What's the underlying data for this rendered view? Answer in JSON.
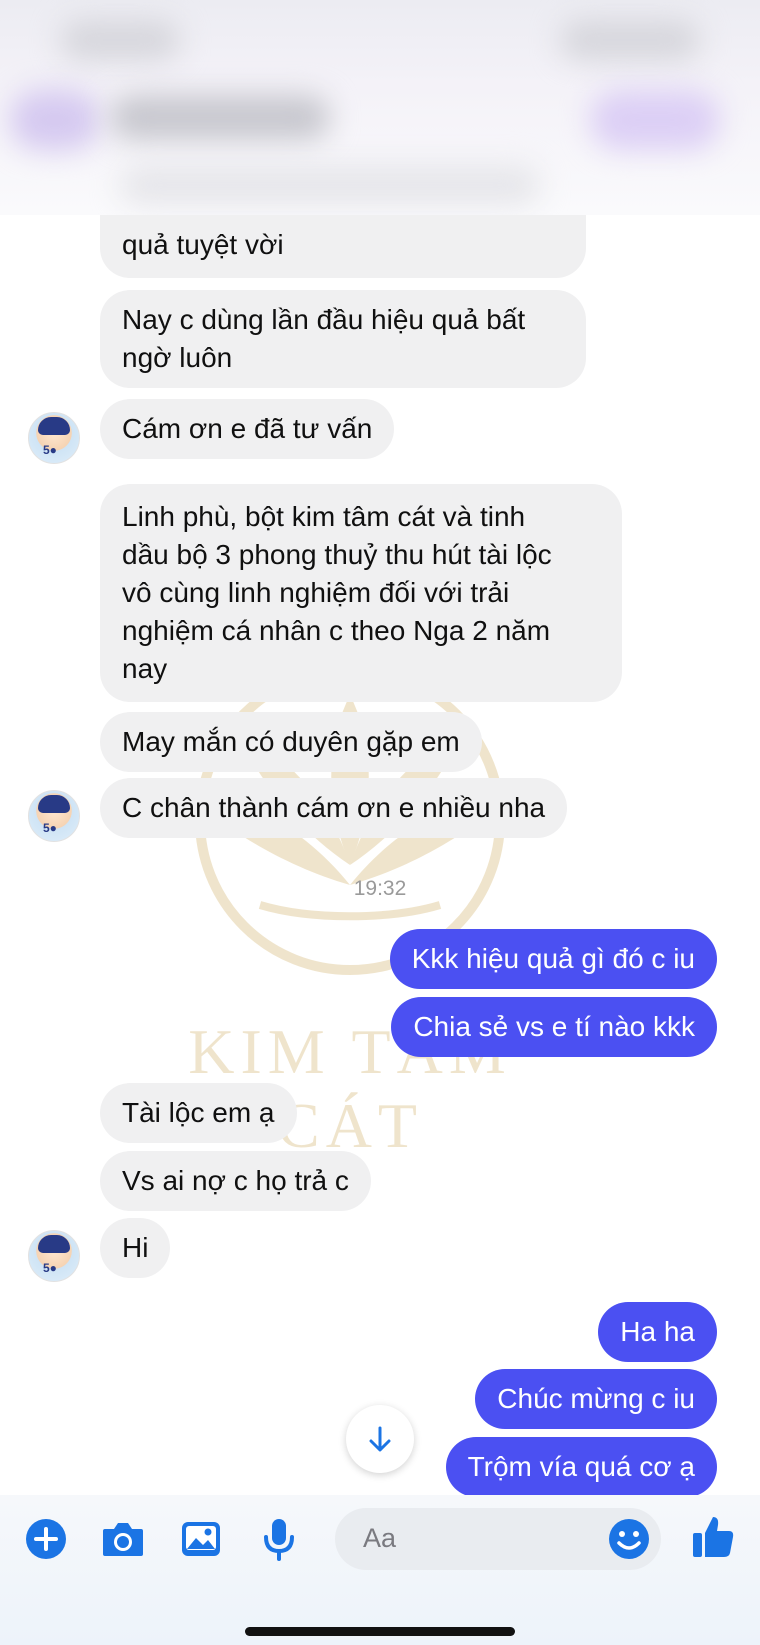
{
  "messages": {
    "m1": "quả tuyệt vời",
    "m2a": "Nay c dùng lần đầu hiệu quả bất",
    "m2b": "ngờ luôn",
    "m3": "Cám ơn e đã tư vấn",
    "m4a": "Linh phù, bột kim tâm cát và tinh",
    "m4b": "dầu bộ 3 phong thuỷ thu hút tài lộc",
    "m4c": "vô cùng linh nghiệm đối với trải",
    "m4d": "nghiệm cá nhân c theo Nga 2 năm",
    "m4e": "nay",
    "m5": "May mắn có duyên gặp em",
    "m6": "C chân thành cám ơn e nhiều nha",
    "time": "19:32",
    "o1": "Kkk hiệu quả gì đó c iu",
    "o2": "Chia sẻ vs e tí nào kkk",
    "m7": "Tài lộc em ạ",
    "m8": "Vs ai nợ c họ trả c",
    "m9": "Hi",
    "o3": "Ha ha",
    "o4": "Chúc mừng c iu",
    "o5": "Trộm vía quá cơ ạ"
  },
  "watermark": {
    "brand": "KIM TÂM CÁT",
    "color": "#c9a24a"
  },
  "composer": {
    "placeholder": "Aa"
  },
  "colors": {
    "accent": "#4b50f2",
    "incoming": "#f0f0f1",
    "icon": "#1b74e4"
  },
  "icons": [
    "plus-icon",
    "camera-icon",
    "image-icon",
    "microphone-icon",
    "emoji-icon",
    "thumbs-up-icon",
    "arrow-down-icon"
  ]
}
